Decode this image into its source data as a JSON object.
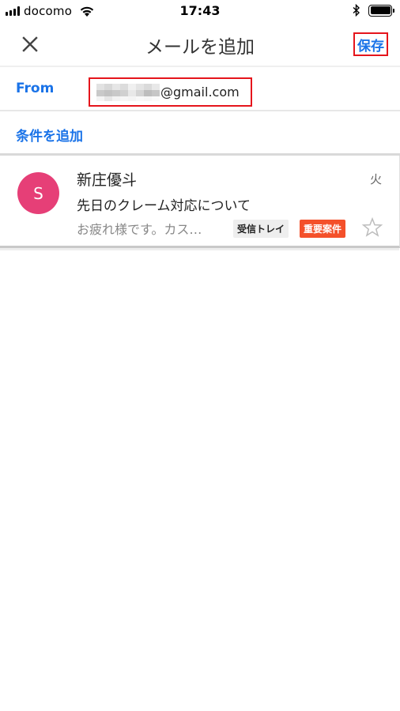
{
  "status_bar": {
    "carrier": "docomo",
    "time": "17:43",
    "signal_bars": 4,
    "battery_level": 1.0
  },
  "app_bar": {
    "title": "メールを追加",
    "close_icon": "close-icon",
    "save_label": "保存"
  },
  "filter": {
    "from_label": "From",
    "from_value_masked": true,
    "from_value_domain": "@gmail.com",
    "add_condition_label": "条件を追加"
  },
  "mail": {
    "avatar_initial": "S",
    "avatar_color": "#e63f77",
    "sender": "新庄優斗",
    "date": "火",
    "subject": "先日のクレーム対応について",
    "snippet": "お疲れ様です。カス…",
    "labels": [
      {
        "text": "受信トレイ",
        "bg": "#eeeeee",
        "color": "#222222"
      },
      {
        "text": "重要案件",
        "bg": "#f4502a",
        "color": "#ffffff"
      }
    ],
    "starred": false
  },
  "colors": {
    "accent": "#1a73e8",
    "highlight_box": "#e5151c"
  }
}
